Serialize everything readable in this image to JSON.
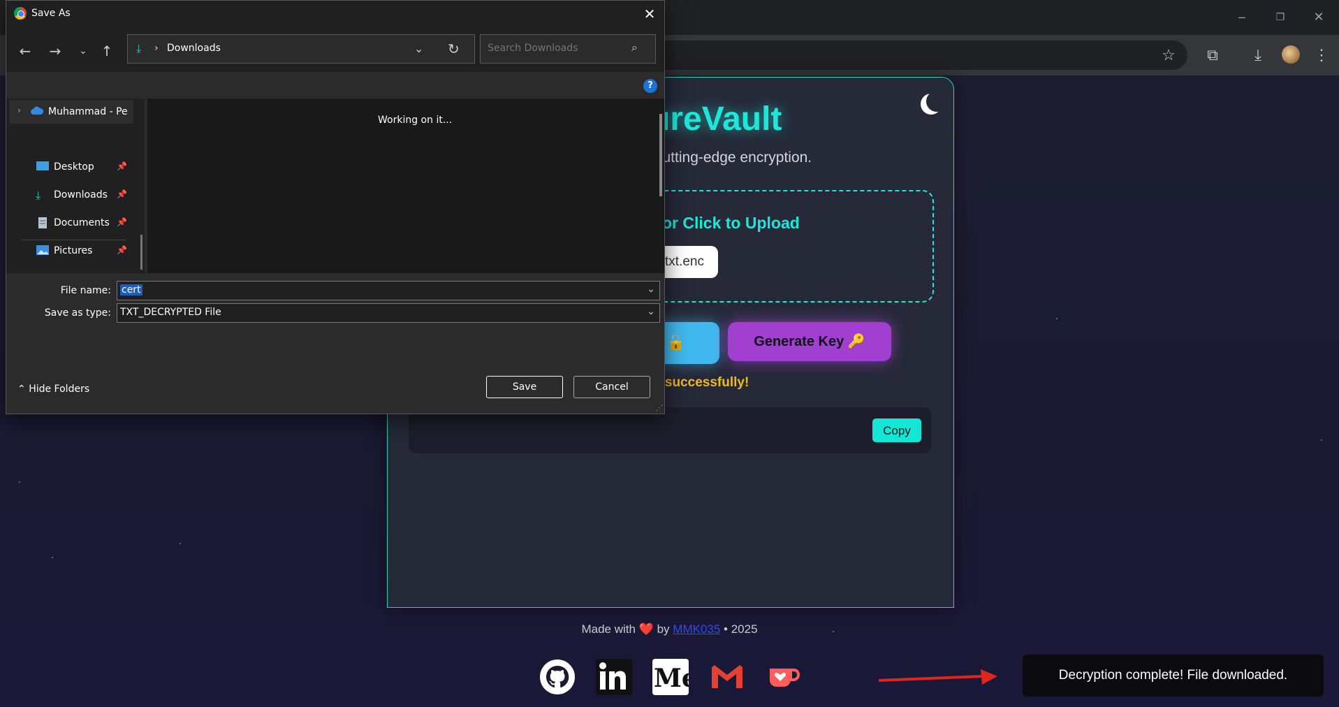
{
  "browser": {
    "window_controls": {
      "minimize": "–",
      "restore": "❐",
      "close": "✕"
    },
    "toolbar_icons": [
      "star-icon",
      "extensions-icon",
      "download-icon",
      "profile-avatar",
      "menu-icon"
    ]
  },
  "app": {
    "brand_partial": "ureVault",
    "tagline_partial": "cutting-edge encryption.",
    "upload_text_partial": "or Click to Upload",
    "file_chip_partial": "txt.enc",
    "decrypt_button_partial": "t 🔓",
    "generate_key_button": "Generate Key 🔑",
    "status_partial": "d successfully!",
    "copy_button": "Copy",
    "footer": {
      "made_with": "Made with",
      "heart": "❤️",
      "by": "by",
      "author_link": "MMK035",
      "year": "• 2025"
    },
    "social": [
      "github-icon",
      "linkedin-icon",
      "medium-icon",
      "gmail-icon",
      "kofi-icon"
    ],
    "toast": "Decryption complete! File downloaded."
  },
  "dialog": {
    "title": "Save As",
    "address": {
      "separator": "›",
      "location": "Downloads"
    },
    "search_placeholder": "Search Downloads",
    "help": "?",
    "sidebar": {
      "onedrive": "Muhammad - Pe",
      "items": [
        {
          "label": "Desktop"
        },
        {
          "label": "Downloads"
        },
        {
          "label": "Documents"
        },
        {
          "label": "Pictures"
        }
      ]
    },
    "working_message": "Working on it...",
    "file_name_label": "File name:",
    "file_name_value": "cert",
    "save_as_type_label": "Save as type:",
    "save_as_type_value": "TXT_DECRYPTED File",
    "hide_folders": "Hide Folders",
    "save_button": "Save",
    "cancel_button": "Cancel"
  },
  "colors": {
    "accent": "#1ee6d8",
    "purple": "#a13fd0",
    "blue": "#41b8ee",
    "status": "#f3b81c"
  }
}
